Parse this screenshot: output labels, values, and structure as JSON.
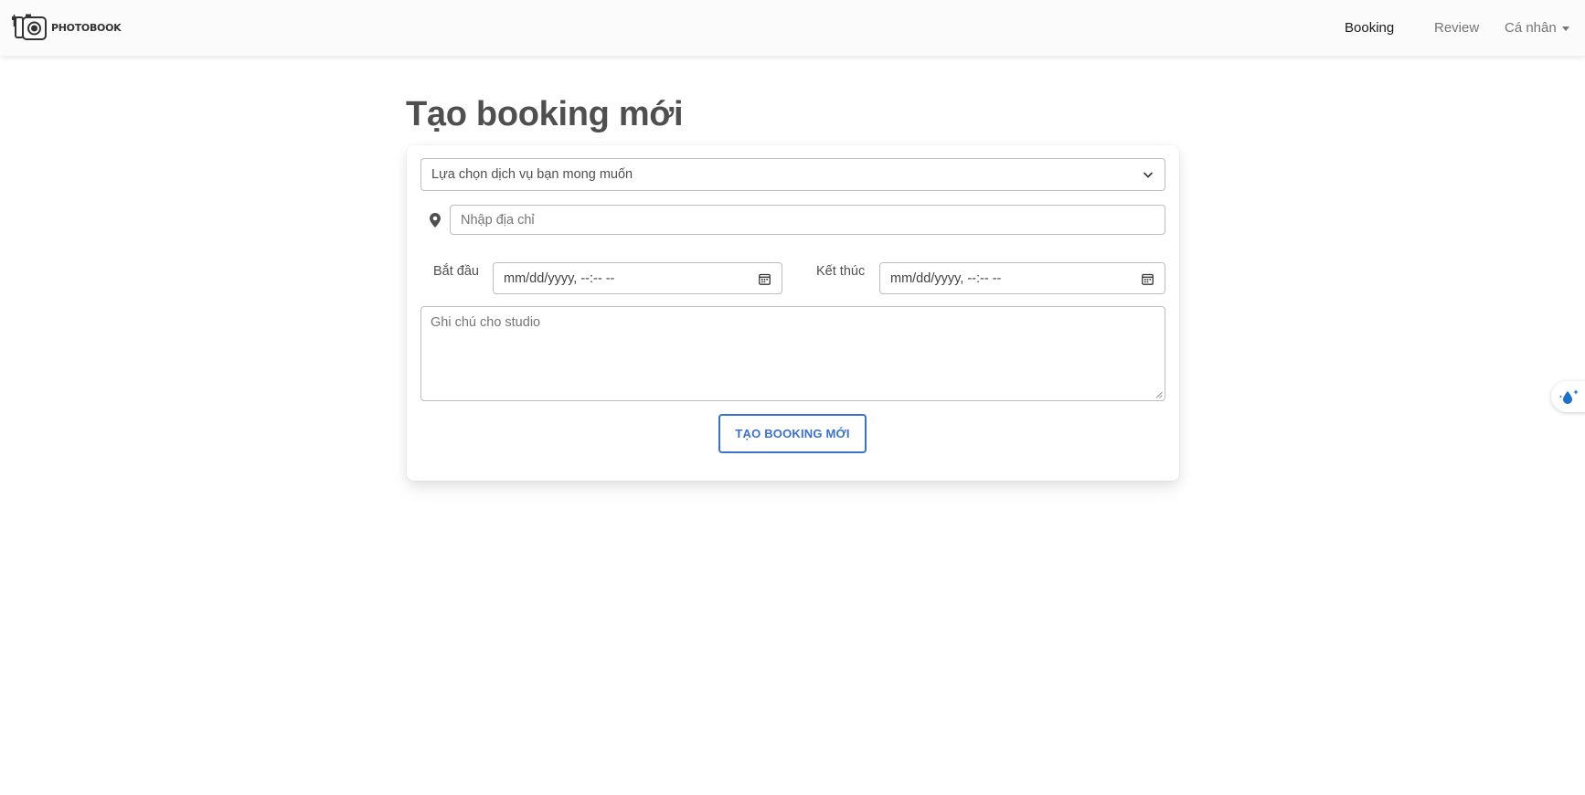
{
  "brand": {
    "name": "PHOTOBOOK",
    "icon": "camera-logo-icon"
  },
  "nav": {
    "items": [
      {
        "label": "Booking",
        "active": true
      },
      {
        "label": "Review",
        "active": false
      },
      {
        "label": "Cá nhân",
        "dropdown": true
      }
    ]
  },
  "page": {
    "title": "Tạo booking mới"
  },
  "form": {
    "service_select": {
      "value": "Lựa chọn dịch vụ bạn mong muốn",
      "icon": "chevron-down-icon"
    },
    "address": {
      "placeholder": "Nhập địa chỉ",
      "icon": "map-pin-icon"
    },
    "start": {
      "label": "Bắt đầu",
      "value": "mm/dd/yyyy, --:-- --",
      "icon": "calendar-icon"
    },
    "end": {
      "label": "Kết thúc",
      "value": "mm/dd/yyyy, --:-- --",
      "icon": "calendar-icon"
    },
    "note": {
      "placeholder": "Ghi chú cho studio"
    },
    "submit_label": "TẠO BOOKING MỚI"
  },
  "side_widget": {
    "icon": "water-drop-sparkle-icon"
  },
  "colors": {
    "primary": "#3b71ca",
    "navbar_bg": "#fbfbfb",
    "text": "#4f4f4f"
  }
}
